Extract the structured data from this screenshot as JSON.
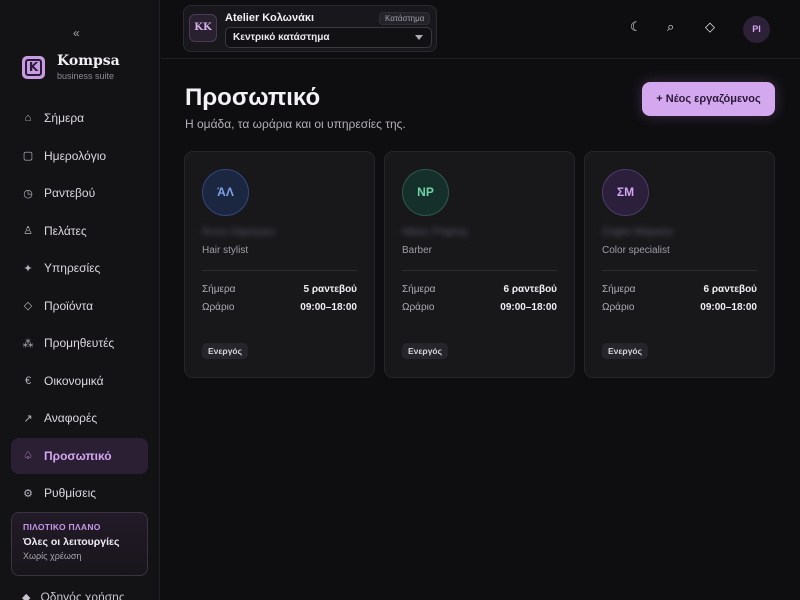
{
  "sidebar": {
    "collapse_glyph": "«",
    "brand": {
      "name": "Kompsa",
      "subtitle": "business suite",
      "logo_letter": "K",
      "accent": "#c79be2"
    },
    "items": [
      {
        "label": "Σήμερα",
        "icon": "home-icon",
        "glyph": "⌂",
        "active": false
      },
      {
        "label": "Ημερολόγιο",
        "icon": "calendar-icon",
        "glyph": "▢",
        "active": false
      },
      {
        "label": "Ραντεβού",
        "icon": "clock-icon",
        "glyph": "◷",
        "active": false
      },
      {
        "label": "Πελάτες",
        "icon": "user-icon",
        "glyph": "♙",
        "active": false
      },
      {
        "label": "Υπηρεσίες",
        "icon": "sparkle-icon",
        "glyph": "✦",
        "active": false
      },
      {
        "label": "Προϊόντα",
        "icon": "diamond-icon",
        "glyph": "◇",
        "active": false
      },
      {
        "label": "Προμηθευτές",
        "icon": "nodes-icon",
        "glyph": "⁂",
        "active": false
      },
      {
        "label": "Οικονομικά",
        "icon": "euro-icon",
        "glyph": "€",
        "active": false
      },
      {
        "label": "Αναφορές",
        "icon": "trend-icon",
        "glyph": "↗",
        "active": false
      },
      {
        "label": "Προσωπικό",
        "icon": "staff-icon",
        "glyph": "♤",
        "active": true
      },
      {
        "label": "Ρυθμίσεις",
        "icon": "gear-icon",
        "glyph": "⚙",
        "active": false
      }
    ],
    "plan": {
      "tag": "ΠΙΛΟΤΙΚΟ ΠΛΑΝΟ",
      "title": "Όλες οι λειτουργίες",
      "subtitle": "Χωρίς χρέωση"
    },
    "bottom_link": {
      "label": "Οδηγός χρήσης",
      "glyph": "◆"
    }
  },
  "topbar": {
    "store": {
      "initials": "KK",
      "name": "Atelier Κολωνάκι",
      "badge": "Κατάστημα",
      "selected": "Κεντρικό κατάστημα"
    },
    "icons": [
      {
        "name": "theme-moon-icon",
        "glyph": "☾"
      },
      {
        "name": "search-icon",
        "glyph": "⌕"
      },
      {
        "name": "diamond-icon",
        "glyph": "◇"
      }
    ],
    "user_initials": "PI"
  },
  "main": {
    "title": "Προσωπικό",
    "subtitle": "Η ομάδα, τα ωράρια και οι υπηρεσίες της.",
    "add_button": "+ Νέος εργαζόμενος",
    "cards": [
      {
        "initials": "ΆΛ",
        "name": "Άννα Λάμπρου",
        "role": "Hair stylist",
        "today_label": "Σήμερα",
        "today_value": "5 ραντεβού",
        "hours_label": "Ωράριο",
        "hours_value": "09:00–18:00",
        "status": "Ενεργός",
        "color": "#7fa2e6",
        "bg": "#1b2640",
        "border": "#33477a"
      },
      {
        "initials": "NP",
        "name": "Νίκος Ραφτης",
        "role": "Barber",
        "today_label": "Σήμερα",
        "today_value": "6 ραντεβού",
        "hours_label": "Ωράριο",
        "hours_value": "09:00–18:00",
        "status": "Ενεργός",
        "color": "#6fd3a6",
        "bg": "#15302a",
        "border": "#2c5a4b"
      },
      {
        "initials": "ΣΜ",
        "name": "Σοφία Μάρκου",
        "role": "Color specialist",
        "today_label": "Σήμερα",
        "today_value": "6 ραντεβού",
        "hours_label": "Ωράριο",
        "hours_value": "09:00–18:00",
        "status": "Ενεργός",
        "color": "#d3a6f2",
        "bg": "#2c1f3c",
        "border": "#4e3a6a"
      }
    ]
  }
}
